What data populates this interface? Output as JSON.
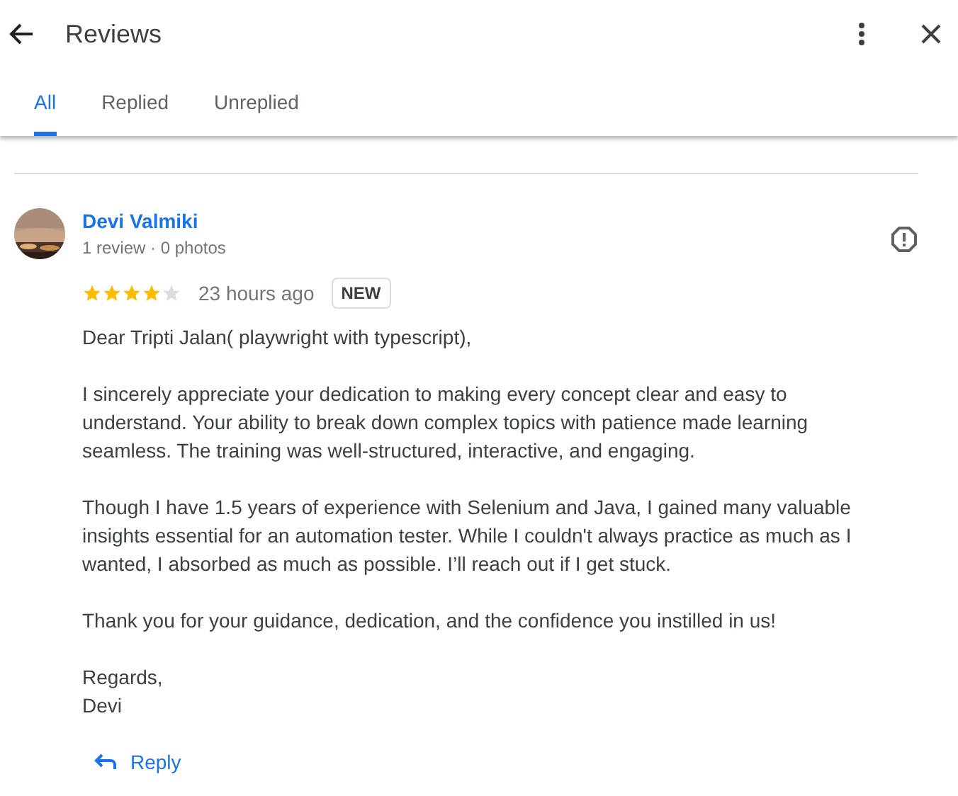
{
  "header": {
    "title": "Reviews"
  },
  "tabs": [
    {
      "label": "All",
      "selected": true
    },
    {
      "label": "Replied",
      "selected": false
    },
    {
      "label": "Unreplied",
      "selected": false
    }
  ],
  "review": {
    "author": "Devi Valmiki",
    "meta": "1 review · 0 photos",
    "stars": 4,
    "time": "23 hours ago",
    "badge": "NEW",
    "paragraphs": [
      "Dear Tripti Jalan( playwright with typescript),",
      "I sincerely appreciate your dedication to making every concept clear and easy to understand. Your ability to break down complex topics with patience made learning seamless. The training was well-structured, interactive, and engaging.",
      "Though I have 1.5 years of experience with Selenium and Java, I gained many valuable insights essential for an automation tester. While I couldn't always practice as much as I wanted, I absorbed as much as possible. I’ll reach out if I get stuck.",
      "Thank you for your guidance, dedication, and the confidence you instilled in us!",
      "Regards,\nDevi"
    ],
    "reply_label": "Reply"
  }
}
